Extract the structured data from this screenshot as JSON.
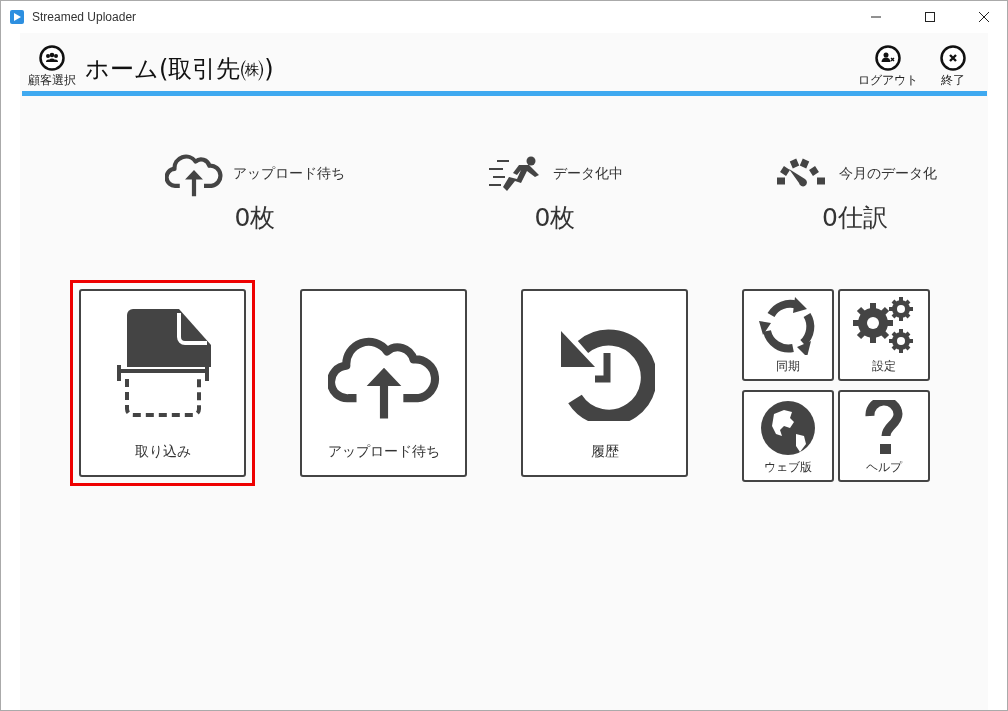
{
  "window": {
    "title": "Streamed Uploader"
  },
  "header": {
    "customer_button": "顧客選択",
    "title": "ホーム(取引先㈱)",
    "logout_button": "ログアウト",
    "exit_button": "終了"
  },
  "stats": [
    {
      "kind": "upload",
      "label": "アップロード待ち",
      "value": "0枚"
    },
    {
      "kind": "running",
      "label": "データ化中",
      "value": "0枚"
    },
    {
      "kind": "gauge",
      "label": "今月のデータ化",
      "value": "0仕訳"
    }
  ],
  "tiles": [
    {
      "kind": "scan",
      "label": "取り込み",
      "highlighted": true
    },
    {
      "kind": "upload",
      "label": "アップロード待ち",
      "highlighted": false
    },
    {
      "kind": "history",
      "label": "履歴",
      "highlighted": false
    }
  ],
  "small_tiles": [
    {
      "kind": "sync",
      "label": "同期"
    },
    {
      "kind": "settings",
      "label": "設定"
    },
    {
      "kind": "web",
      "label": "ウェブ版"
    },
    {
      "kind": "help",
      "label": "ヘルプ"
    }
  ]
}
